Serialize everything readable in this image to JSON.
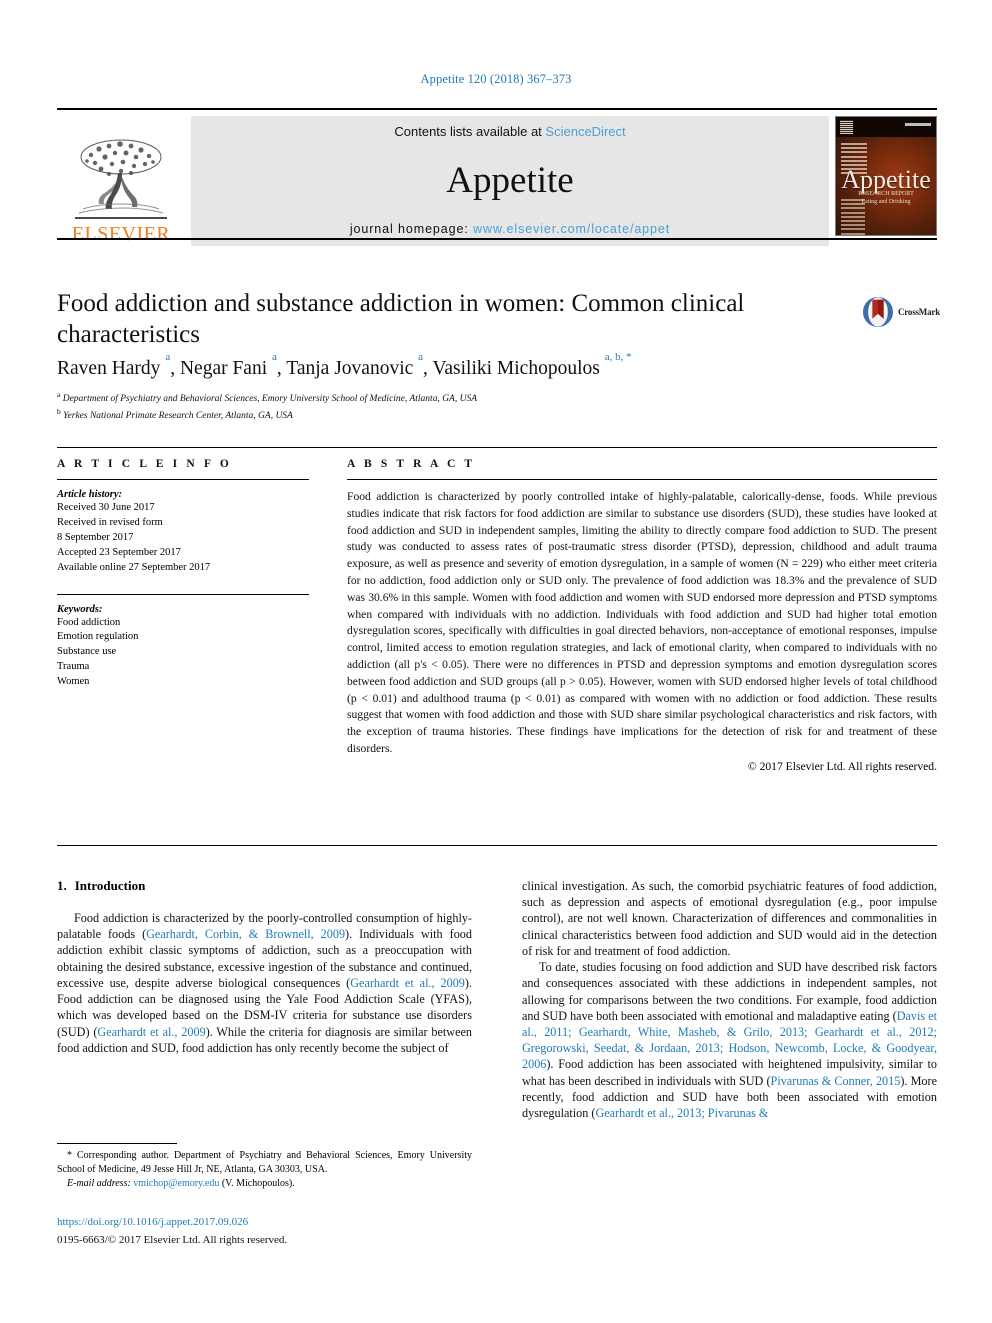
{
  "running_head": "Appetite 120 (2018) 367–373",
  "masthead": {
    "publisher_name": "ELSEVIER",
    "contents_prefix": "Contents lists available at",
    "contents_link": "ScienceDirect",
    "journal_name": "Appetite",
    "homepage_prefix": "journal homepage:",
    "homepage_url": "www.elsevier.com/locate/appet",
    "cover": {
      "title": "Appetite",
      "subtitle_line1": "RESEARCH REPORT",
      "subtitle_line2": "Eating and Drinking"
    }
  },
  "article": {
    "title": "Food addiction and substance addiction in women: Common clinical characteristics",
    "crossmark_label": "CrossMark",
    "authors_html": "Raven Hardy <sup>a</sup>, Negar Fani <sup>a</sup>, Tanja Jovanovic <sup>a</sup>, Vasiliki Michopoulos <sup>a, b, *</sup>",
    "affiliation_a": "Department of Psychiatry and Behavioral Sciences, Emory University School of Medicine, Atlanta, GA, USA",
    "affiliation_b": "Yerkes National Primate Research Center, Atlanta, GA, USA"
  },
  "article_info": {
    "heading": "A R T I C L E   I N F O",
    "history_label": "Article history:",
    "history_lines": [
      "Received 30 June 2017",
      "Received in revised form",
      "8 September 2017",
      "Accepted 23 September 2017",
      "Available online 27 September 2017"
    ],
    "keywords_label": "Keywords:",
    "keywords": [
      "Food addiction",
      "Emotion regulation",
      "Substance use",
      "Trauma",
      "Women"
    ]
  },
  "abstract": {
    "heading": "A B S T R A C T",
    "text": "Food addiction is characterized by poorly controlled intake of highly-palatable, calorically-dense, foods. While previous studies indicate that risk factors for food addiction are similar to substance use disorders (SUD), these studies have looked at food addiction and SUD in independent samples, limiting the ability to directly compare food addiction to SUD. The present study was conducted to assess rates of post-traumatic stress disorder (PTSD), depression, childhood and adult trauma exposure, as well as presence and severity of emotion dysregulation, in a sample of women (N = 229) who either meet criteria for no addiction, food addiction only or SUD only. The prevalence of food addiction was 18.3% and the prevalence of SUD was 30.6% in this sample. Women with food addiction and women with SUD endorsed more depression and PTSD symptoms when compared with individuals with no addiction. Individuals with food addiction and SUD had higher total emotion dysregulation scores, specifically with difficulties in goal directed behaviors, non-acceptance of emotional responses, impulse control, limited access to emotion regulation strategies, and lack of emotional clarity, when compared to individuals with no addiction (all p's < 0.05). There were no differences in PTSD and depression symptoms and emotion dysregulation scores between food addiction and SUD groups (all p > 0.05). However, women with SUD endorsed higher levels of total childhood (p < 0.01) and adulthood trauma (p < 0.01) as compared with women with no addiction or food addiction. These results suggest that women with food addiction and those with SUD share similar psychological characteristics and risk factors, with the exception of trauma histories. These findings have implications for the detection of risk for and treatment of these disorders.",
    "copyright": "© 2017 Elsevier Ltd. All rights reserved."
  },
  "introduction": {
    "number": "1.",
    "title": "Introduction",
    "left_paragraph_1_pre": "Food addiction is characterized by the poorly-controlled consumption of highly-palatable foods (",
    "left_cite_1": "Gearhardt, Corbin, & Brownell, 2009",
    "left_paragraph_1_mid": "). Individuals with food addiction exhibit classic symptoms of addiction, such as a preoccupation with obtaining the desired substance, excessive ingestion of the substance and continued, excessive use, despite adverse biological consequences (",
    "left_cite_2": "Gearhardt et al., 2009",
    "left_paragraph_1_mid2": "). Food addiction can be diagnosed using the Yale Food Addiction Scale (YFAS), which was developed based on the DSM-IV criteria for substance use disorders (SUD) (",
    "left_cite_3": "Gearhardt et al., 2009",
    "left_paragraph_1_end": "). While the criteria for diagnosis are similar between food addiction and SUD, food addiction has only recently become the subject of",
    "right_paragraph_1": "clinical investigation. As such, the comorbid psychiatric features of food addiction, such as depression and aspects of emotional dysregulation (e.g., poor impulse control), are not well known. Characterization of differences and commonalities in clinical characteristics between food addiction and SUD would aid in the detection of risk for and treatment of food addiction.",
    "right_paragraph_2_pre": "To date, studies focusing on food addiction and SUD have described risk factors and consequences associated with these addictions in independent samples, not allowing for comparisons between the two conditions. For example, food addiction and SUD have both been associated with emotional and maladaptive eating (",
    "right_cite_1": "Davis et al., 2011; Gearhardt, White, Masheb, & Grilo, 2013; Gearhardt et al., 2012; Gregorowski, Seedat, & Jordaan, 2013; Hodson, Newcomb, Locke, & Goodyear, 2006",
    "right_paragraph_2_mid": "). Food addiction has been associated with heightened impulsivity, similar to what has been described in individuals with SUD (",
    "right_cite_2": "Pivarunas & Conner, 2015",
    "right_paragraph_2_mid2": "). More recently, food addiction and SUD have both been associated with emotion dysregulation (",
    "right_cite_3": "Gearhardt et al., 2013; Pivarunas &"
  },
  "footnote": {
    "marker": "*",
    "corresponding_text": "Corresponding author. Department of Psychiatry and Behavioral Sciences, Emory University School of Medicine, 49 Jesse Hill Jr, NE, Atlanta, GA 30303, USA.",
    "email_label": "E-mail address:",
    "email": "vmichop@emory.edu",
    "email_suffix": "(V. Michopoulos)."
  },
  "publication_footer": {
    "doi": "https://doi.org/10.1016/j.appet.2017.09.026",
    "issn_line": "0195-6663/© 2017 Elsevier Ltd. All rights reserved."
  },
  "colors": {
    "link_blue": "#1f7bb6",
    "sciencedirect_blue": "#4a9fd6",
    "elsevier_orange": "#f07d1a",
    "contents_bg": "#e6e6e6"
  }
}
